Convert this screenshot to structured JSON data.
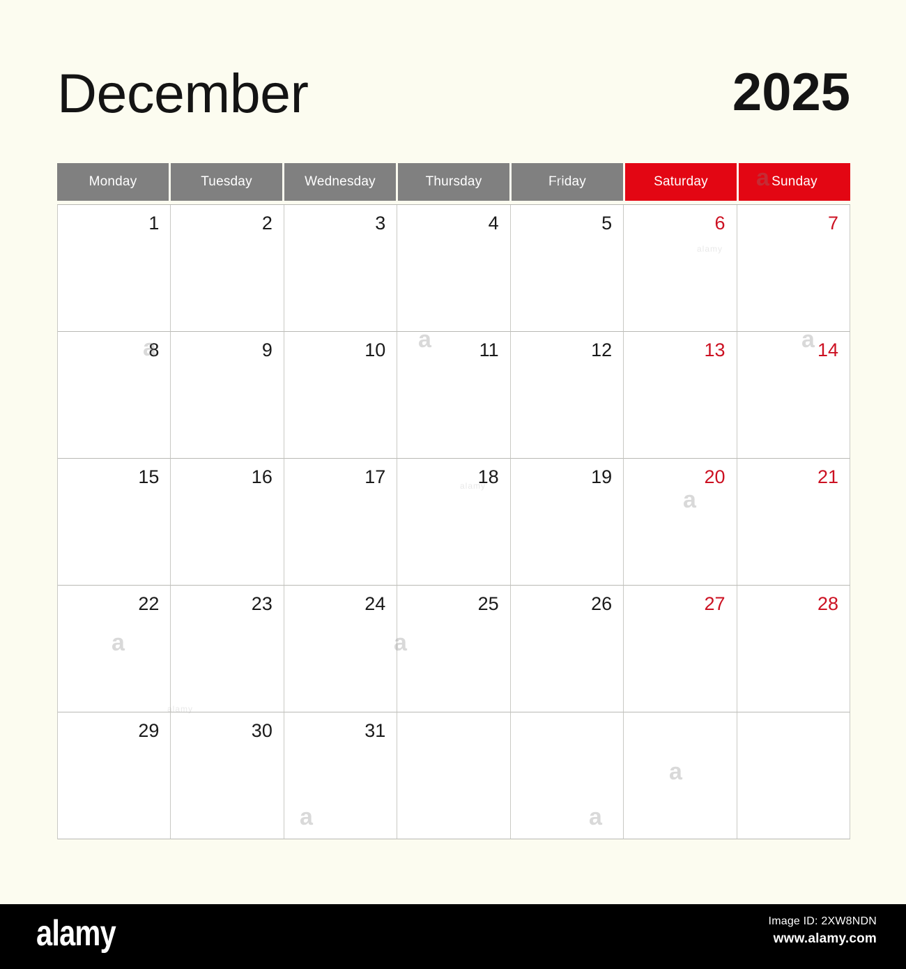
{
  "background_color": "#fcfcf0",
  "header": {
    "month": "December",
    "year": "2025"
  },
  "colors": {
    "weekday_header_bg": "#808080",
    "weekend_header_bg": "#e30613",
    "weekend_date_text": "#cc1122",
    "weekday_date_text": "#1a1a1a",
    "cell_bg": "#ffffff",
    "grid_line": "#c9c9c4"
  },
  "weekdays": [
    {
      "label": "Monday",
      "weekend": false
    },
    {
      "label": "Tuesday",
      "weekend": false
    },
    {
      "label": "Wednesday",
      "weekend": false
    },
    {
      "label": "Thursday",
      "weekend": false
    },
    {
      "label": "Friday",
      "weekend": false
    },
    {
      "label": "Saturday",
      "weekend": true
    },
    {
      "label": "Sunday",
      "weekend": true
    }
  ],
  "weeks": [
    [
      {
        "day": "1",
        "weekend": false
      },
      {
        "day": "2",
        "weekend": false
      },
      {
        "day": "3",
        "weekend": false
      },
      {
        "day": "4",
        "weekend": false
      },
      {
        "day": "5",
        "weekend": false
      },
      {
        "day": "6",
        "weekend": true
      },
      {
        "day": "7",
        "weekend": true
      }
    ],
    [
      {
        "day": "8",
        "weekend": false
      },
      {
        "day": "9",
        "weekend": false
      },
      {
        "day": "10",
        "weekend": false
      },
      {
        "day": "11",
        "weekend": false
      },
      {
        "day": "12",
        "weekend": false
      },
      {
        "day": "13",
        "weekend": true
      },
      {
        "day": "14",
        "weekend": true
      }
    ],
    [
      {
        "day": "15",
        "weekend": false
      },
      {
        "day": "16",
        "weekend": false
      },
      {
        "day": "17",
        "weekend": false
      },
      {
        "day": "18",
        "weekend": false
      },
      {
        "day": "19",
        "weekend": false
      },
      {
        "day": "20",
        "weekend": true
      },
      {
        "day": "21",
        "weekend": true
      }
    ],
    [
      {
        "day": "22",
        "weekend": false
      },
      {
        "day": "23",
        "weekend": false
      },
      {
        "day": "24",
        "weekend": false
      },
      {
        "day": "25",
        "weekend": false
      },
      {
        "day": "26",
        "weekend": false
      },
      {
        "day": "27",
        "weekend": true
      },
      {
        "day": "28",
        "weekend": true
      }
    ],
    [
      {
        "day": "29",
        "weekend": false
      },
      {
        "day": "30",
        "weekend": false
      },
      {
        "day": "31",
        "weekend": false
      },
      {
        "day": "",
        "weekend": false
      },
      {
        "day": "",
        "weekend": false
      },
      {
        "day": "",
        "weekend": true
      },
      {
        "day": "",
        "weekend": true
      }
    ]
  ],
  "watermark": {
    "glyph": "a",
    "caption": "alamy"
  },
  "footer": {
    "logo": "alamy",
    "image_id": "Image ID: 2XW8NDN",
    "url": "www.alamy.com"
  }
}
